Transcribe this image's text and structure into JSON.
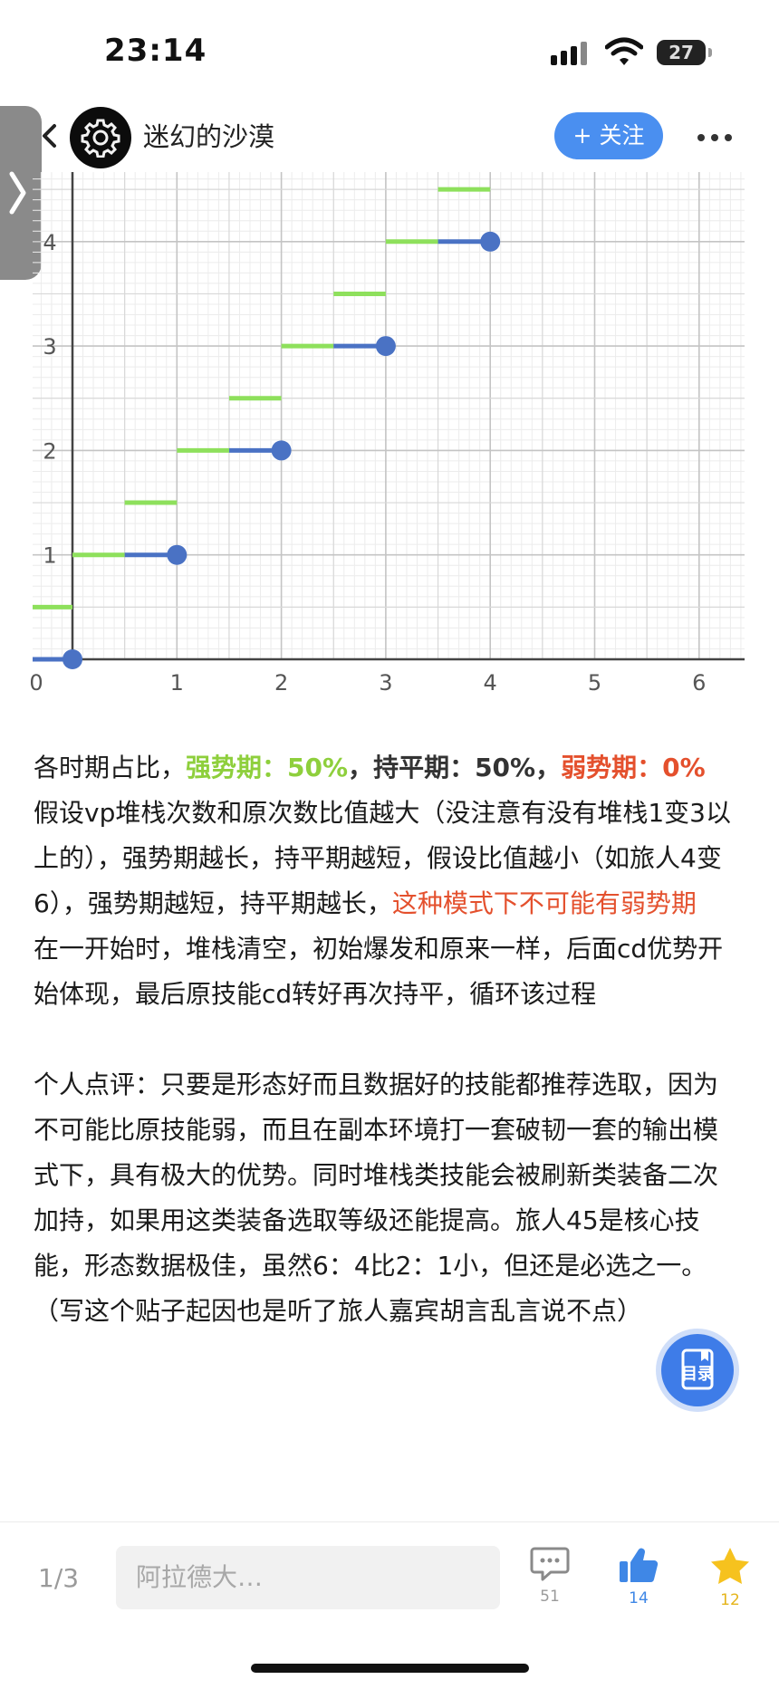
{
  "status_bar": {
    "time": "23:14",
    "battery": "27"
  },
  "header": {
    "author": "迷幻的沙漠",
    "follow_label": "+ 关注"
  },
  "chart_data": {
    "type": "line",
    "x_ticks": [
      "0",
      "1",
      "2",
      "3",
      "4",
      "5",
      "6"
    ],
    "y_ticks": [
      "1",
      "2",
      "3",
      "4"
    ],
    "xlim": [
      0,
      6.5
    ],
    "ylim": [
      0,
      4.5
    ],
    "grid": true,
    "series": [
      {
        "style": "green",
        "segments": [
          [
            [
              -0.4,
              0.5
            ],
            [
              0,
              0.5
            ]
          ],
          [
            [
              0,
              1
            ],
            [
              0.5,
              1
            ]
          ],
          [
            [
              0.5,
              1.5
            ],
            [
              1,
              1.5
            ]
          ],
          [
            [
              1,
              2
            ],
            [
              1.5,
              2
            ]
          ],
          [
            [
              1.5,
              2.5
            ],
            [
              2,
              2.5
            ]
          ],
          [
            [
              2,
              3
            ],
            [
              2.5,
              3
            ]
          ],
          [
            [
              2.5,
              3.5
            ],
            [
              3,
              3.5
            ]
          ],
          [
            [
              3,
              4
            ],
            [
              3.5,
              4
            ]
          ],
          [
            [
              3.5,
              4.5
            ],
            [
              4,
              4.5
            ]
          ]
        ]
      },
      {
        "style": "blue",
        "segments": [
          [
            [
              -0.4,
              0
            ],
            [
              0,
              0
            ]
          ],
          [
            [
              0.5,
              1
            ],
            [
              1,
              1
            ]
          ],
          [
            [
              1.5,
              2
            ],
            [
              2,
              2
            ]
          ],
          [
            [
              2.5,
              3
            ],
            [
              3,
              3
            ]
          ],
          [
            [
              3.5,
              4
            ],
            [
              4,
              4
            ]
          ]
        ],
        "points": [
          [
            0,
            0
          ],
          [
            1,
            1
          ],
          [
            2,
            2
          ],
          [
            3,
            3
          ],
          [
            4,
            4
          ]
        ]
      }
    ],
    "colors": {
      "green": "#8ee05c",
      "blue": "#4a72c4"
    }
  },
  "article": {
    "line1_prefix": "各时期占比，",
    "line1_strong": "强势期：50%",
    "line1_sep": "，",
    "line1_even": "持平期：50%",
    "line1_sep2": "，",
    "line1_weak": "弱势期：0%",
    "para2_text": "假设vp堆栈次数和原次数比值越大（没注意有没有堆栈1变3以上的），强势期越长，持平期越短，假设比值越小（如旅人4变6），强势期越短，持平期越长，",
    "para2_red": "这种模式下不可能有弱势期",
    "para3": "在一开始时，堆栈清空，初始爆发和原来一样，后面cd优势开始体现，最后原技能cd转好再次持平，循环该过程",
    "para4": "个人点评：只要是形态好而且数据好的技能都推荐选取，因为不可能比原技能弱，而且在副本环境打一套破韧一套的输出模式下，具有极大的优势。同时堆栈类技能会被刷新类装备二次加持，如果用这类装备选取等级还能提高。旅人45是核心技能，形态数据极佳，虽然6：4比2：1小，但还是必选之一。（写这个贴子起因也是听了旅人嘉宾胡言乱言说不点）"
  },
  "toc_label": "目录",
  "bottom_bar": {
    "page": "1/3",
    "input_placeholder": "阿拉德大…",
    "comment_count": "51",
    "like_count": "14",
    "star_count": "12"
  }
}
